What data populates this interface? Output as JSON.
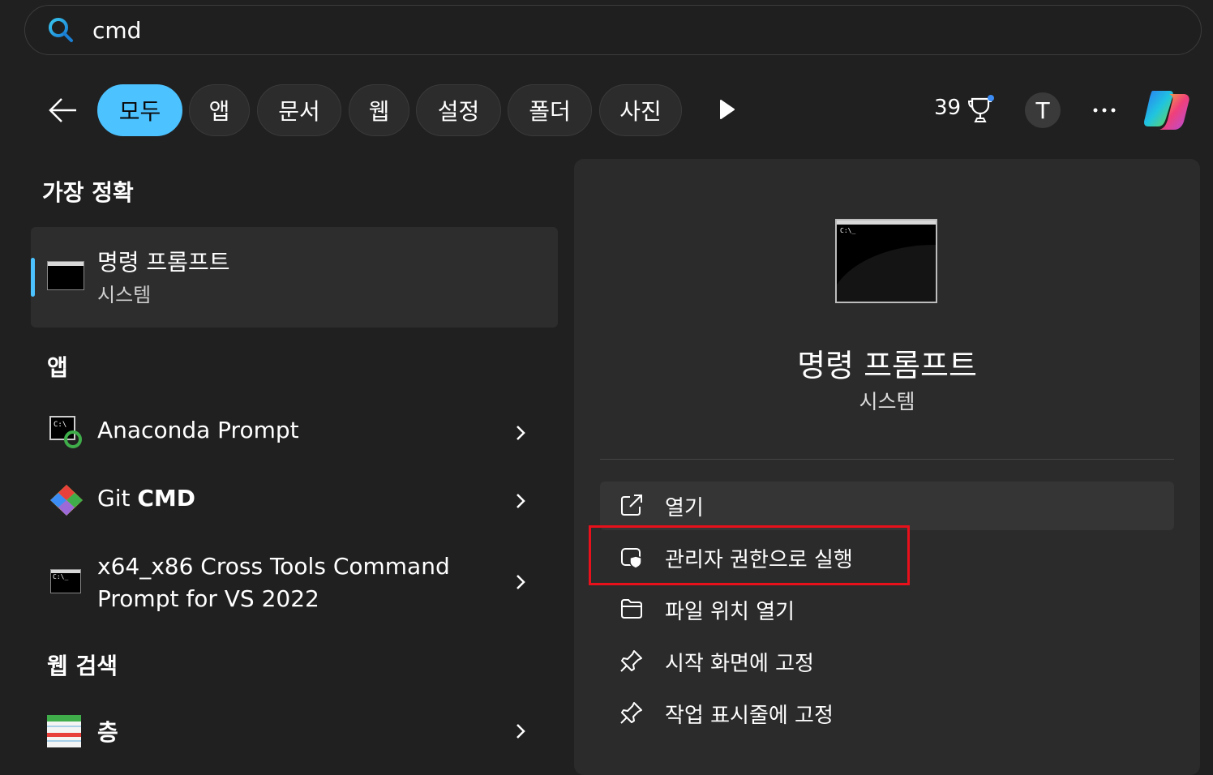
{
  "search": {
    "value": "cmd"
  },
  "filters": [
    "모두",
    "앱",
    "문서",
    "웹",
    "설정",
    "폴더",
    "사진"
  ],
  "active_filter": "모두",
  "header": {
    "points": "39",
    "avatar_initial": "T"
  },
  "best_match": {
    "section_title": "가장 정확",
    "name": "명령 프롬프트",
    "type": "시스템"
  },
  "apps": {
    "section_title": "앱",
    "items": [
      {
        "name": "Anaconda Prompt"
      },
      {
        "name_prefix": "Git ",
        "name_bold": "CMD"
      },
      {
        "line1": "x64_x86 Cross Tools Command",
        "line2": "Prompt for VS 2022"
      }
    ]
  },
  "web": {
    "section_title": "웹 검색",
    "items": [
      {
        "name": "층"
      }
    ]
  },
  "detail": {
    "icon_caption": "C:\\_",
    "title": "명령 프롬프트",
    "subtitle": "시스템",
    "actions": [
      {
        "label": "열기",
        "icon": "open-external-icon"
      },
      {
        "label": "관리자 권한으로 실행",
        "icon": "admin-shield-icon"
      },
      {
        "label": "파일 위치 열기",
        "icon": "folder-icon"
      },
      {
        "label": "시작 화면에 고정",
        "icon": "pin-icon"
      },
      {
        "label": "작업 표시줄에 고정",
        "icon": "pin-icon"
      }
    ]
  },
  "colors": {
    "accent": "#4cc2ff",
    "highlight": "#e8101b",
    "background": "#202020",
    "panel": "#2b2b2b"
  }
}
